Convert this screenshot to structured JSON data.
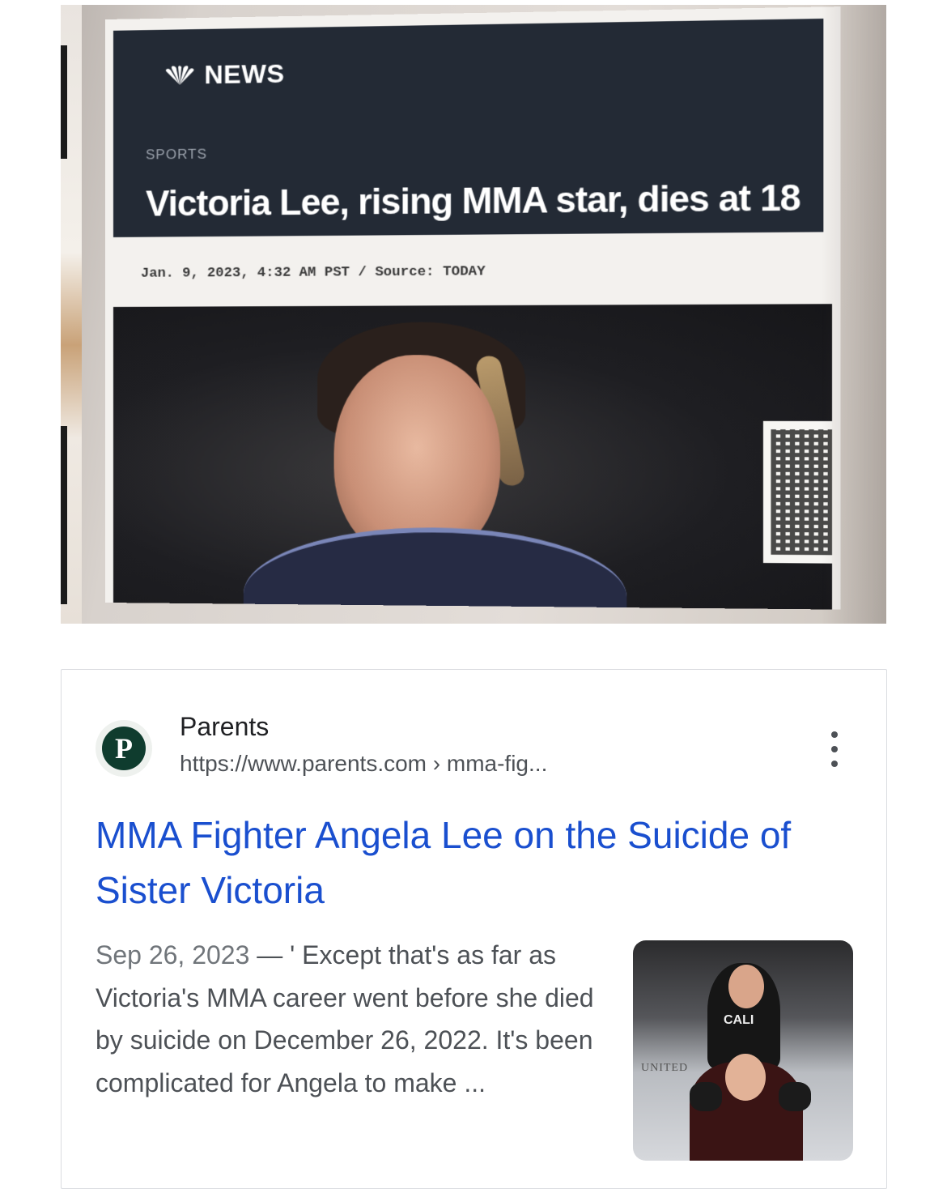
{
  "news_photo": {
    "brand": "NEWS",
    "section": "SPORTS",
    "headline": "Victoria Lee, rising MMA star, dies at 18",
    "dateline": "Jan. 9, 2023, 4:32 AM PST / Source: TODAY"
  },
  "result": {
    "site_name": "Parents",
    "favicon_letter": "P",
    "url": "https://www.parents.com › mma-fig...",
    "title": "MMA Fighter Angela Lee on the Suicide of Sister Victoria",
    "snippet_date": "Sep 26, 2023",
    "snippet_text": " — ' Except that's as far as Victoria's MMA career went before she died by suicide on December 26, 2022. It's been complicated for Angela to make ...",
    "thumbnail": {
      "wall_text": "UNITED",
      "shirt_text": "CALI"
    }
  },
  "colors": {
    "link": "#1a4fcf",
    "favicon_bg": "#0f3c2e",
    "header_band": "#232a35"
  }
}
